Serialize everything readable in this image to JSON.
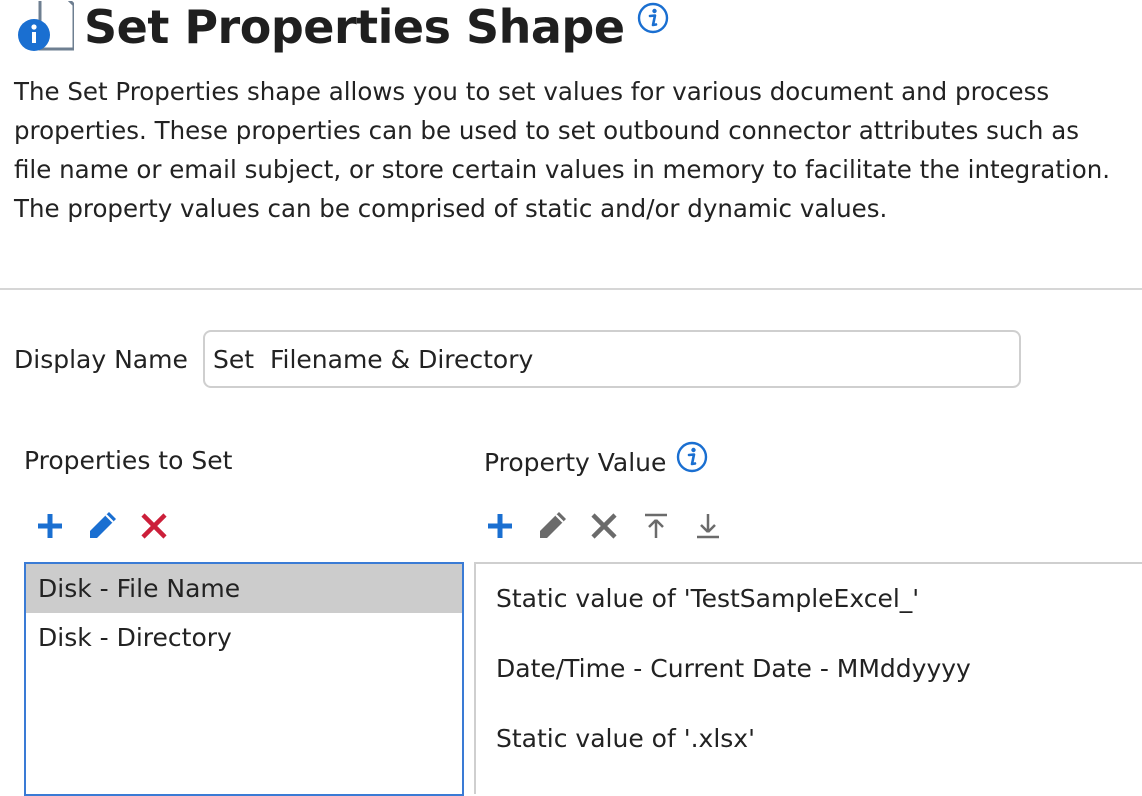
{
  "header": {
    "title": "Set Properties Shape",
    "page_icon": "document-info-icon",
    "info_icon": "info-icon"
  },
  "description": "The Set Properties shape allows you to set values for various document and process properties. These properties can be used to set outbound connector attributes such as file name or email subject, or store certain values in memory to facilitate the integration. The property values can be comprised of static and/or dynamic values.",
  "display_name": {
    "label": "Display Name",
    "value": "Set  Filename & Directory"
  },
  "properties_to_set": {
    "label": "Properties to Set",
    "toolbar": [
      {
        "name": "add-icon",
        "color": "#1a6fd1"
      },
      {
        "name": "edit-icon",
        "color": "#1a6fd1"
      },
      {
        "name": "delete-icon",
        "color": "#cc1f3a"
      }
    ],
    "items": [
      {
        "label": "Disk - File Name",
        "selected": true
      },
      {
        "label": "Disk - Directory",
        "selected": false
      }
    ]
  },
  "property_value": {
    "label": "Property Value",
    "info_icon": "info-icon",
    "toolbar": [
      {
        "name": "add-icon",
        "color": "#1a6fd1"
      },
      {
        "name": "edit-icon",
        "color": "#6b6b6b"
      },
      {
        "name": "delete-icon",
        "color": "#6b6b6b"
      },
      {
        "name": "move-to-top-icon",
        "color": "#6b6b6b"
      },
      {
        "name": "move-to-bottom-icon",
        "color": "#6b6b6b"
      }
    ],
    "items": [
      {
        "label": "Static value of 'TestSampleExcel_'"
      },
      {
        "label": "Date/Time - Current Date - MMddyyyy"
      },
      {
        "label": "Static value of '.xlsx'"
      }
    ]
  },
  "colors": {
    "accent_blue": "#1a6fd1",
    "delete_red": "#cc1f3a",
    "selection_gray": "#cccccc",
    "list_border": "#3a7bd5"
  }
}
